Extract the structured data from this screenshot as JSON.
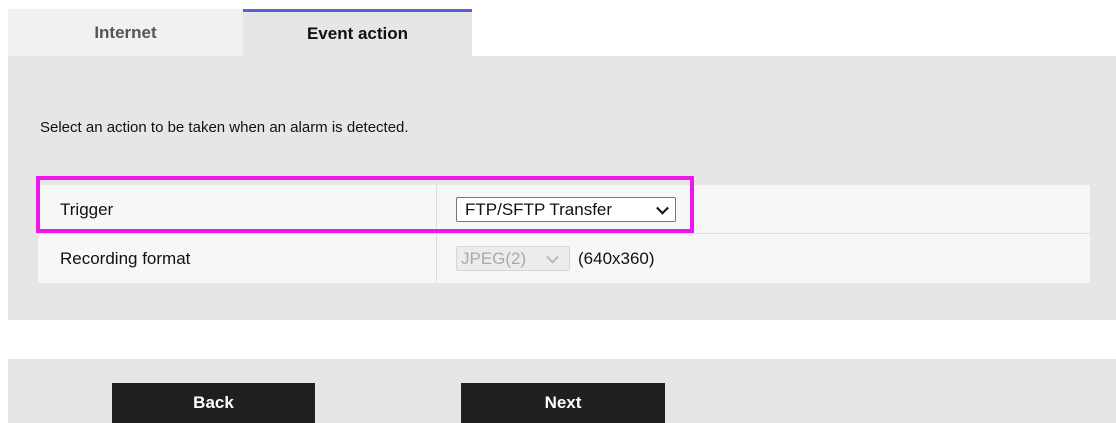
{
  "tabs": [
    {
      "label": "Internet",
      "active": false
    },
    {
      "label": "Event action",
      "active": true
    }
  ],
  "instruction": "Select an action to be taken when an alarm is detected.",
  "settings": {
    "trigger": {
      "label": "Trigger",
      "value": "FTP/SFTP Transfer"
    },
    "recording_format": {
      "label": "Recording format",
      "value": "JPEG(2)",
      "resolution": "(640x360)",
      "disabled": true
    }
  },
  "buttons": {
    "back_label": "Back",
    "next_label": "Next"
  },
  "colors": {
    "highlight": "#ee18ee",
    "active_tab_accent": "#5563d6",
    "button_bg": "#1f1f1f",
    "panel_bg": "#e6e6e6"
  },
  "icons": {
    "select_arrow": "chevron-down-icon"
  }
}
